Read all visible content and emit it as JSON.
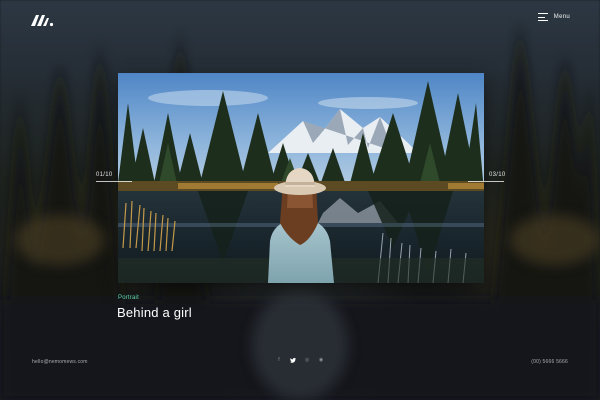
{
  "header": {
    "logo_name": "brand-logo",
    "menu_label": "Menu"
  },
  "slider": {
    "current": "01/10",
    "next": "03/10"
  },
  "slide": {
    "category": "Portrait",
    "title": "Behind a girl"
  },
  "footer": {
    "email": "hello@nemomews.com",
    "phone": "(00) 5666 5666",
    "social": [
      {
        "icon": "facebook-icon",
        "glyph": "f",
        "active": false
      },
      {
        "icon": "twitter-icon",
        "glyph": "🐦",
        "active": true
      },
      {
        "icon": "instagram-icon",
        "glyph": "◎",
        "active": false
      },
      {
        "icon": "dribbble-icon",
        "glyph": "◉",
        "active": false
      }
    ]
  },
  "colors": {
    "accent": "#5cd6b0",
    "text": "#ffffff",
    "muted": "#a9adb2"
  }
}
